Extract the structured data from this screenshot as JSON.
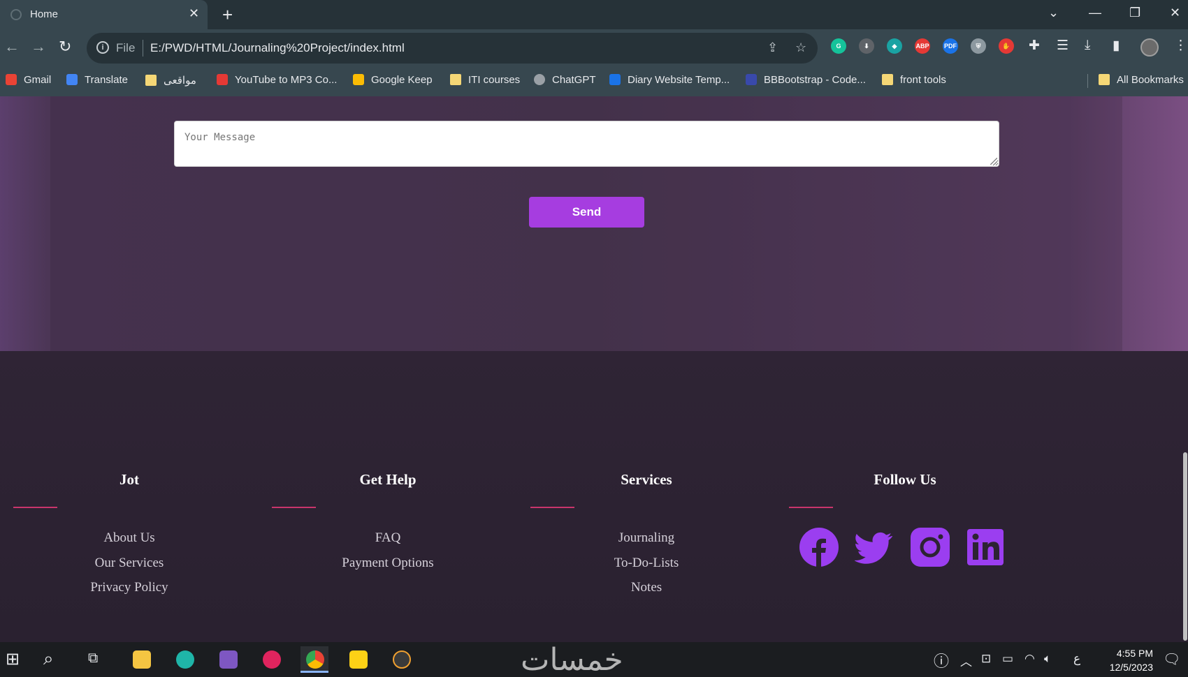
{
  "browser": {
    "tab_title": "Home",
    "tab_close": "✕",
    "new_tab": "+",
    "file_label": "File",
    "url": "E:/PWD/HTML/Journaling%20Project/index.html"
  },
  "extensions": [
    {
      "name": "grammarly",
      "label": "G",
      "color": "#15c39a"
    },
    {
      "name": "download",
      "label": "⬇",
      "color": "#5f6368"
    },
    {
      "name": "ext-diamond",
      "label": "◆",
      "color": "#1aa3a3"
    },
    {
      "name": "adblock",
      "label": "ABP",
      "color": "#e53935"
    },
    {
      "name": "pdf",
      "label": "PDF",
      "color": "#1a73e8"
    },
    {
      "name": "shield",
      "label": "⛨",
      "color": "#8d99a0"
    },
    {
      "name": "red-hand",
      "label": "✋",
      "color": "#e53935"
    }
  ],
  "bookmarks": [
    {
      "label": "Gmail",
      "color": "#ea4335"
    },
    {
      "label": "Translate",
      "color": "#4285f4"
    },
    {
      "label": "مواقعى",
      "color": "#f5d776"
    },
    {
      "label": "YouTube to MP3 Co...",
      "color": "#e53935"
    },
    {
      "label": "Google Keep",
      "color": "#fbbc04"
    },
    {
      "label": "ITI courses",
      "color": "#f5d776"
    },
    {
      "label": "ChatGPT",
      "color": "#9aa0a6"
    },
    {
      "label": "Diary Website Temp...",
      "color": "#1a73e8"
    },
    {
      "label": "BBBootstrap - Code...",
      "color": "#3949ab"
    },
    {
      "label": "front tools",
      "color": "#f5d776"
    }
  ],
  "all_bookmarks": "All Bookmarks",
  "contact": {
    "message_placeholder": "Your Message",
    "send_label": "Send"
  },
  "footer": {
    "columns": [
      {
        "title": "Jot",
        "links": [
          "About Us",
          "Our Services",
          "Privacy Policy"
        ]
      },
      {
        "title": "Get Help",
        "links": [
          "FAQ",
          "Payment Options"
        ]
      },
      {
        "title": "Services",
        "links": [
          "Journaling",
          "To-Do-Lists",
          "Notes"
        ]
      },
      {
        "title": "Follow Us",
        "links": []
      }
    ],
    "accent_color": "#c9356c",
    "social_color": "#9b3ef0",
    "socials": [
      "facebook-icon",
      "twitter-icon",
      "instagram-icon",
      "linkedin-icon"
    ]
  },
  "taskbar": {
    "watermark": "خمسات",
    "time": "4:55 PM",
    "date": "12/5/2023",
    "lang": "ع"
  }
}
